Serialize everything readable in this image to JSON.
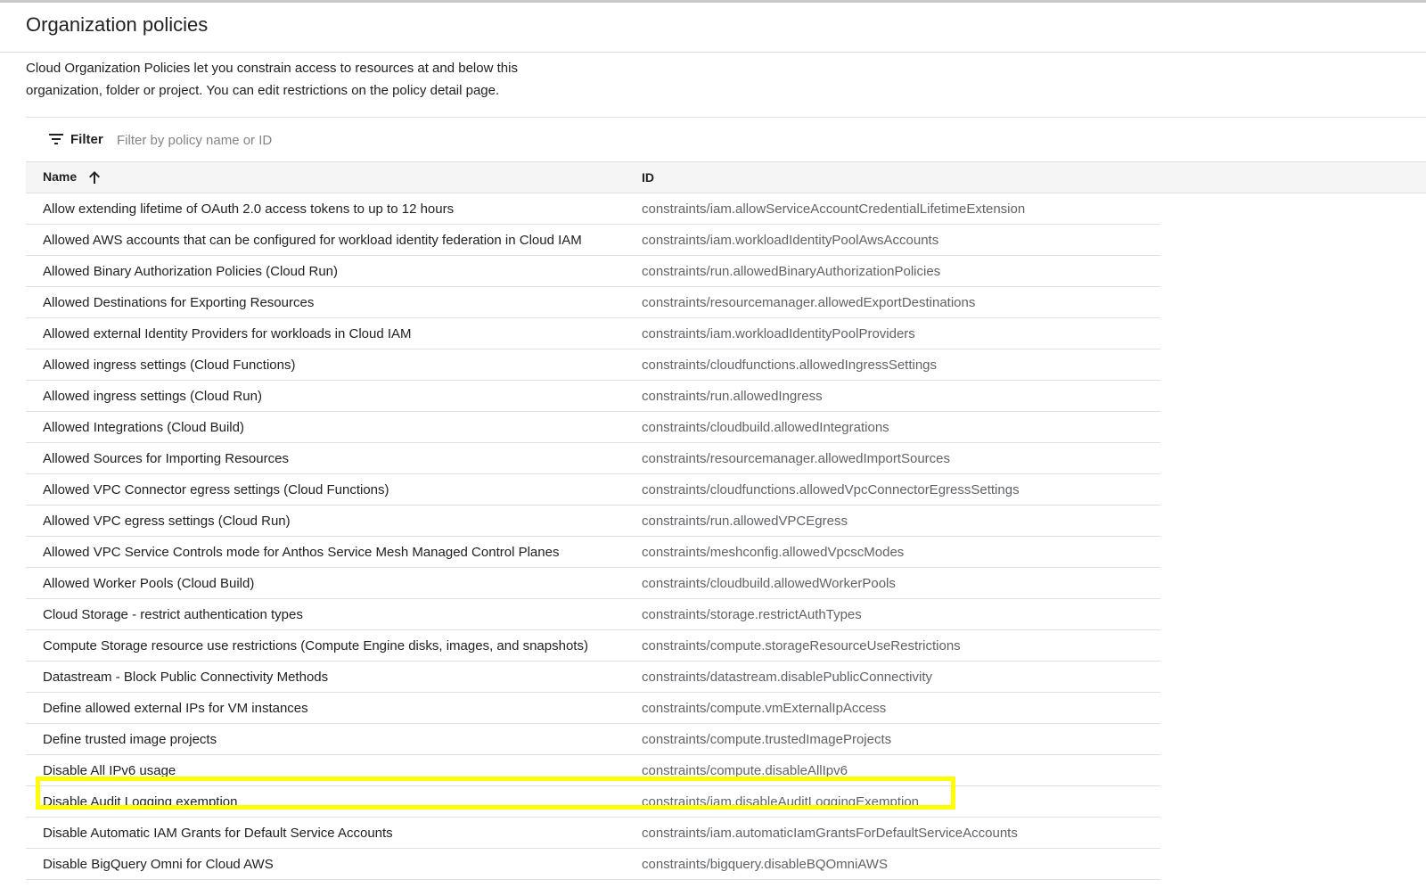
{
  "page": {
    "title": "Organization policies",
    "description": "Cloud Organization Policies let you constrain access to resources at and below this organization, folder or project. You can edit restrictions on the policy detail page."
  },
  "filter": {
    "label": "Filter",
    "placeholder": "Filter by policy name or ID",
    "icon": "filter-icon"
  },
  "table": {
    "columns": {
      "name": "Name",
      "id": "ID"
    },
    "sort": {
      "column": "Name",
      "direction": "ascending",
      "icon": "arrow-up-icon"
    },
    "rows": [
      {
        "name": "Allow extending lifetime of OAuth 2.0 access tokens to up to 12 hours",
        "id": "constraints/iam.allowServiceAccountCredentialLifetimeExtension"
      },
      {
        "name": "Allowed AWS accounts that can be configured for workload identity federation in Cloud IAM",
        "id": "constraints/iam.workloadIdentityPoolAwsAccounts"
      },
      {
        "name": "Allowed Binary Authorization Policies (Cloud Run)",
        "id": "constraints/run.allowedBinaryAuthorizationPolicies"
      },
      {
        "name": "Allowed Destinations for Exporting Resources",
        "id": "constraints/resourcemanager.allowedExportDestinations"
      },
      {
        "name": "Allowed external Identity Providers for workloads in Cloud IAM",
        "id": "constraints/iam.workloadIdentityPoolProviders"
      },
      {
        "name": "Allowed ingress settings (Cloud Functions)",
        "id": "constraints/cloudfunctions.allowedIngressSettings"
      },
      {
        "name": "Allowed ingress settings (Cloud Run)",
        "id": "constraints/run.allowedIngress"
      },
      {
        "name": "Allowed Integrations (Cloud Build)",
        "id": "constraints/cloudbuild.allowedIntegrations"
      },
      {
        "name": "Allowed Sources for Importing Resources",
        "id": "constraints/resourcemanager.allowedImportSources"
      },
      {
        "name": "Allowed VPC Connector egress settings (Cloud Functions)",
        "id": "constraints/cloudfunctions.allowedVpcConnectorEgressSettings"
      },
      {
        "name": "Allowed VPC egress settings (Cloud Run)",
        "id": "constraints/run.allowedVPCEgress"
      },
      {
        "name": "Allowed VPC Service Controls mode for Anthos Service Mesh Managed Control Planes",
        "id": "constraints/meshconfig.allowedVpcscModes"
      },
      {
        "name": "Allowed Worker Pools (Cloud Build)",
        "id": "constraints/cloudbuild.allowedWorkerPools"
      },
      {
        "name": "Cloud Storage - restrict authentication types",
        "id": "constraints/storage.restrictAuthTypes"
      },
      {
        "name": "Compute Storage resource use restrictions (Compute Engine disks, images, and snapshots)",
        "id": "constraints/compute.storageResourceUseRestrictions"
      },
      {
        "name": "Datastream - Block Public Connectivity Methods",
        "id": "constraints/datastream.disablePublicConnectivity"
      },
      {
        "name": "Define allowed external IPs for VM instances",
        "id": "constraints/compute.vmExternalIpAccess"
      },
      {
        "name": "Define trusted image projects",
        "id": "constraints/compute.trustedImageProjects"
      },
      {
        "name": "Disable All IPv6 usage",
        "id": "constraints/compute.disableAllIpv6"
      },
      {
        "name": "Disable Audit Logging exemption",
        "id": "constraints/iam.disableAuditLoggingExemption",
        "highlighted": true
      },
      {
        "name": "Disable Automatic IAM Grants for Default Service Accounts",
        "id": "constraints/iam.automaticIamGrantsForDefaultServiceAccounts"
      },
      {
        "name": "Disable BigQuery Omni for Cloud AWS",
        "id": "constraints/bigquery.disableBQOmniAWS"
      }
    ]
  },
  "colors": {
    "highlight": "#ffff00",
    "header_bg": "#f5f5f5",
    "id_text": "#5f6368",
    "divider": "#e0e0e0"
  }
}
